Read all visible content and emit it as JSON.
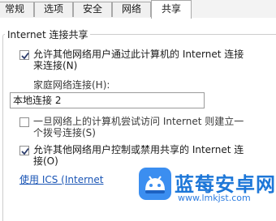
{
  "tabs": [
    {
      "label": "常规"
    },
    {
      "label": "选项"
    },
    {
      "label": "安全"
    },
    {
      "label": "网络"
    },
    {
      "label": "共享",
      "active": true
    }
  ],
  "group": {
    "title": "Internet 连接共享"
  },
  "options": {
    "allow_share_line1": "允许其他网络用户通过此计算机的 Internet 连接",
    "allow_share_line2": "来连接(N)",
    "allow_share_checked": true,
    "home_network_label": "家庭网络连接(H):",
    "home_network_value": "本地连接 2",
    "dial_line1": "一旦网络上的计算机尝试访问 Internet 则建立一",
    "dial_line2": "个拨号连接(S)",
    "dial_checked": false,
    "allow_control_line1": "允许其他网络用户控制或禁用共享的 Internet 连",
    "allow_control_line2": "接(O)",
    "allow_control_checked": true,
    "ics_link": "使用 ICS (Internet"
  },
  "watermark": {
    "title": "蓝莓安卓网",
    "url": "www.lmkjst.com",
    "colors": {
      "title": "#1d77d8",
      "logo_bg": "#3b8ef0"
    }
  }
}
